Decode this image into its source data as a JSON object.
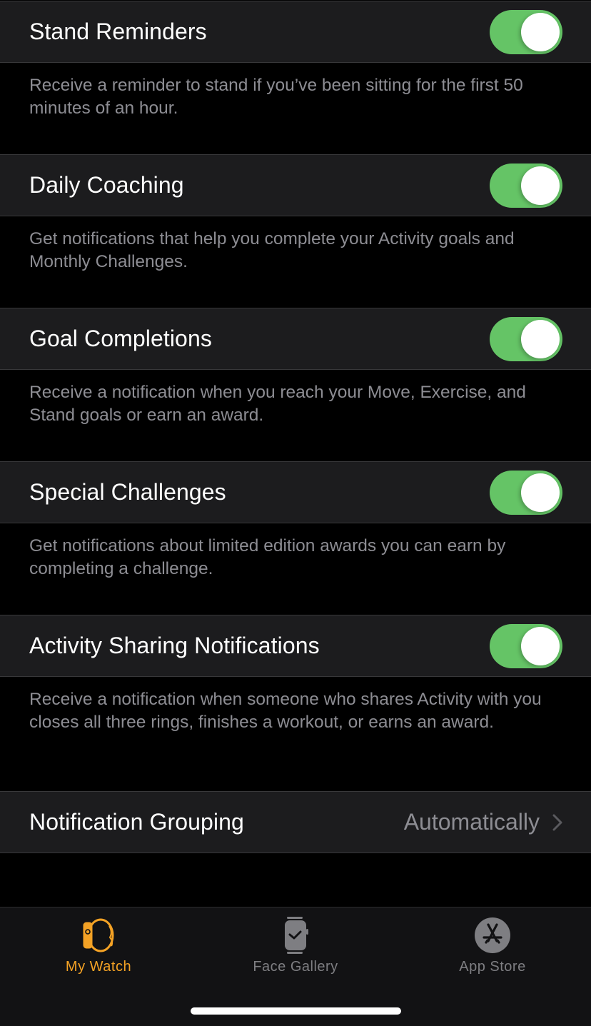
{
  "settings": [
    {
      "label": "Stand Reminders",
      "enabled": true,
      "description": "Receive a reminder to stand if you’ve been sitting for the first 50 minutes of an hour."
    },
    {
      "label": "Daily Coaching",
      "enabled": true,
      "description": "Get notifications that help you complete your Activity goals and Monthly Challenges."
    },
    {
      "label": "Goal Completions",
      "enabled": true,
      "description": "Receive a notification when you reach your Move, Exercise, and Stand goals or earn an award."
    },
    {
      "label": "Special Challenges",
      "enabled": true,
      "description": "Get notifications about limited edition awards you can earn by completing a challenge."
    },
    {
      "label": "Activity Sharing Notifications",
      "enabled": true,
      "description": "Receive a notification when someone who shares Activity with you closes all three rings, finishes a workout, or earns an award."
    }
  ],
  "grouping": {
    "label": "Notification Grouping",
    "value": "Automatically",
    "icon": "chevron-right-icon"
  },
  "tabbar": {
    "active_color": "#f4a225",
    "inactive_color": "#7e7e82",
    "tabs": [
      {
        "label": "My Watch",
        "icon": "watch-outline-icon",
        "active": true
      },
      {
        "label": "Face Gallery",
        "icon": "watch-face-icon",
        "active": false
      },
      {
        "label": "App Store",
        "icon": "app-store-icon",
        "active": false
      }
    ]
  },
  "colors": {
    "toggle_on": "#65c466",
    "row_background": "#1c1c1e",
    "footer_text": "#8d8d93"
  }
}
